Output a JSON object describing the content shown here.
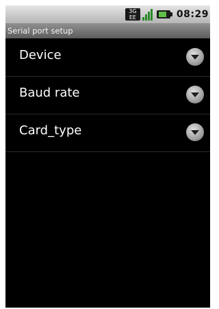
{
  "status_bar": {
    "network_label": "3G",
    "network_sub": "EE",
    "time": "08:29",
    "icons": [
      "network-3g-icon",
      "signal-icon",
      "battery-icon"
    ]
  },
  "title_bar": {
    "title": "Serial port setup"
  },
  "list": {
    "items": [
      {
        "label": "Device",
        "icon": "dropdown-arrow-icon"
      },
      {
        "label": "Baud rate",
        "icon": "dropdown-arrow-icon"
      },
      {
        "label": "Card_type",
        "icon": "dropdown-arrow-icon"
      }
    ]
  },
  "colors": {
    "background": "#000000",
    "text": "#ffffff",
    "status_bar": "#d0d0d0",
    "title_bar": "#6e6e6e",
    "signal": "#2a8a2a",
    "battery": "#5fc04a"
  }
}
